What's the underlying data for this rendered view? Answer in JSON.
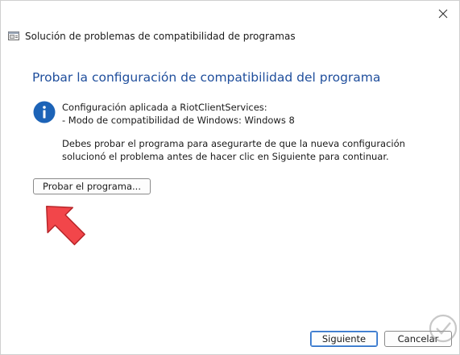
{
  "window": {
    "close_glyph": "✕"
  },
  "header": {
    "title": "Solución de problemas de compatibilidad de programas",
    "icon": "compat-troubleshooter-icon"
  },
  "main": {
    "heading": "Probar la configuración de compatibilidad del programa",
    "info_icon": "info-icon",
    "info_line1": "Configuración aplicada a RiotClientServices:",
    "info_line2": "- Modo de compatibilidad de Windows: Windows 8",
    "description": "Debes probar el programa para asegurarte de que la nueva configuración solucionó el problema antes de hacer clic en Siguiente para continuar.",
    "test_button_label": "Probar el programa..."
  },
  "footer": {
    "next_label": "Siguiente",
    "cancel_label": "Cancelar"
  },
  "colors": {
    "heading": "#1f4e9c",
    "info_circle": "#1c63b7",
    "arrow": "#f2464a",
    "default_button_border": "#2f6fc7"
  }
}
